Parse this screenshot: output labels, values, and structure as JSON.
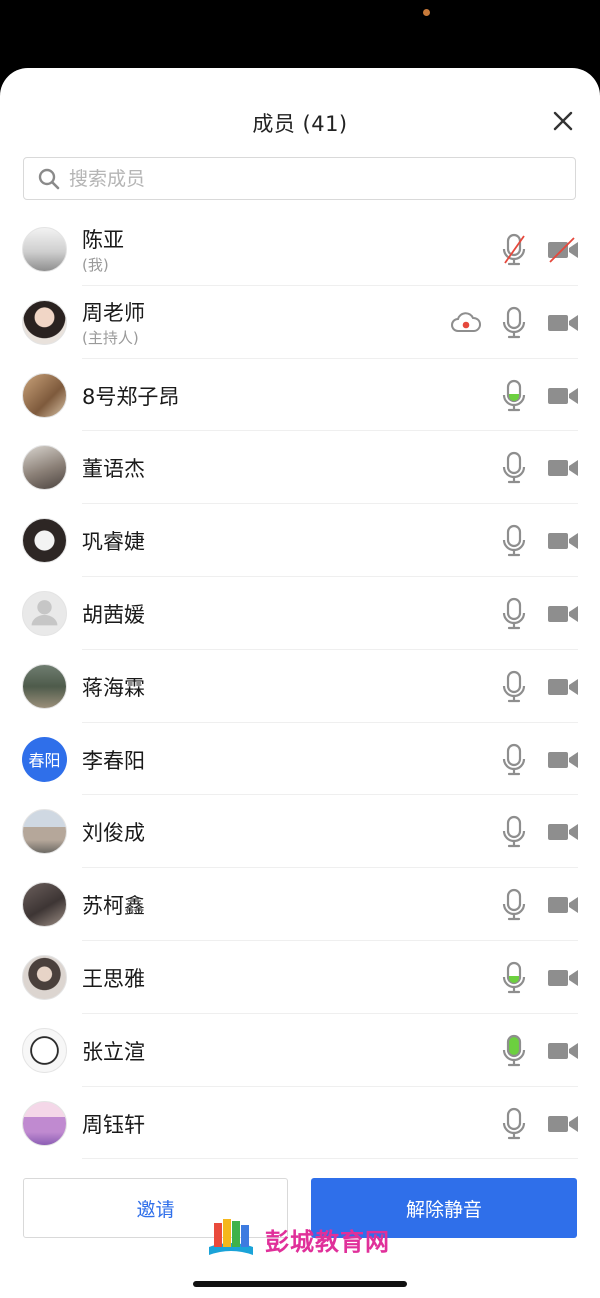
{
  "header": {
    "title": "成员 (41)"
  },
  "search": {
    "placeholder": "搜索成员"
  },
  "members": [
    {
      "name": "陈亚",
      "role": "(我)",
      "mic": "muted",
      "camera": "off",
      "avatar": "photo",
      "recording": false
    },
    {
      "name": "周老师",
      "role": "(主持人)",
      "mic": "normal",
      "camera": "normal",
      "avatar": "photo",
      "recording": true
    },
    {
      "name": "8号郑子昂",
      "role": "",
      "mic": "speaking-low",
      "camera": "normal",
      "avatar": "photo",
      "recording": false
    },
    {
      "name": "董语杰",
      "role": "",
      "mic": "normal",
      "camera": "normal",
      "avatar": "photo",
      "recording": false
    },
    {
      "name": "巩睿婕",
      "role": "",
      "mic": "normal",
      "camera": "normal",
      "avatar": "photo",
      "recording": false
    },
    {
      "name": "胡茜媛",
      "role": "",
      "mic": "normal",
      "camera": "normal",
      "avatar": "default",
      "recording": false
    },
    {
      "name": "蒋海霖",
      "role": "",
      "mic": "normal",
      "camera": "normal",
      "avatar": "photo",
      "recording": false
    },
    {
      "name": "李春阳",
      "role": "",
      "mic": "normal",
      "camera": "normal",
      "avatar": "text",
      "avatar_text": "春阳",
      "recording": false
    },
    {
      "name": "刘俊成",
      "role": "",
      "mic": "normal",
      "camera": "normal",
      "avatar": "photo",
      "recording": false
    },
    {
      "name": "苏柯鑫",
      "role": "",
      "mic": "normal",
      "camera": "normal",
      "avatar": "photo",
      "recording": false
    },
    {
      "name": "王思雅",
      "role": "",
      "mic": "speaking-low",
      "camera": "normal",
      "avatar": "photo",
      "recording": false
    },
    {
      "name": "张立渲",
      "role": "",
      "mic": "speaking-high",
      "camera": "normal",
      "avatar": "photo",
      "recording": false
    },
    {
      "name": "周钰轩",
      "role": "",
      "mic": "normal",
      "camera": "normal",
      "avatar": "photo",
      "recording": false
    }
  ],
  "footer": {
    "invite_label": "邀请",
    "unmute_label": "解除静音"
  },
  "watermark": {
    "text": "彭城教育网"
  },
  "colors": {
    "accent": "#2f6fea",
    "speaking": "#6cd03f",
    "muted_slash": "#e5483c",
    "icon_gray": "#8e8e8e"
  }
}
